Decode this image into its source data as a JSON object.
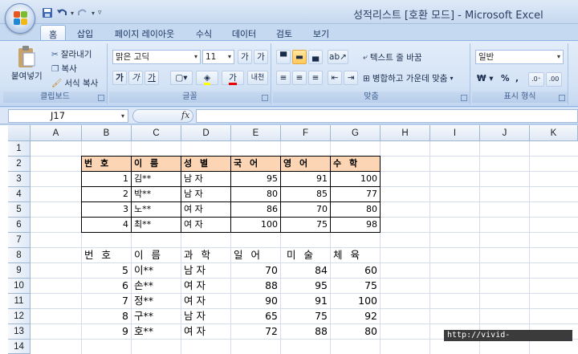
{
  "app": {
    "title": "성적리스트  [호환 모드] - Microsoft Excel"
  },
  "tabs": [
    "홈",
    "삽입",
    "페이지 레이아웃",
    "수식",
    "데이터",
    "검토",
    "보기"
  ],
  "ribbon": {
    "clipboard": {
      "paste": "붙여넣기",
      "cut": "잘라내기",
      "copy": "복사",
      "format_painter": "서식 복사",
      "label": "클립보드"
    },
    "font": {
      "name": "맑은 고딕",
      "size": "11",
      "bold": "가",
      "italic": "가",
      "underline": "가",
      "label": "글꼴",
      "phonetic": "내천"
    },
    "alignment": {
      "wrap": "텍스트 줄 바꿈",
      "merge": "병합하고 가운데 맞춤",
      "label": "맞춤"
    },
    "number": {
      "format": "일반",
      "label": "표시 형식"
    }
  },
  "formula_bar": {
    "cell_ref": "J17",
    "fx": "fx",
    "value": ""
  },
  "columns": [
    "A",
    "B",
    "C",
    "D",
    "E",
    "F",
    "G",
    "H",
    "I",
    "J",
    "K"
  ],
  "rows": [
    "1",
    "2",
    "3",
    "4",
    "5",
    "6",
    "7",
    "8",
    "9",
    "10",
    "11",
    "12",
    "13",
    "14"
  ],
  "table1": {
    "headers": [
      "번 호",
      "이 름",
      "성 별",
      "국 어",
      "영 어",
      "수 학"
    ],
    "rows": [
      [
        "1",
        "김**",
        "남 자",
        "95",
        "91",
        "100"
      ],
      [
        "2",
        "박**",
        "남 자",
        "80",
        "85",
        "77"
      ],
      [
        "3",
        "노**",
        "여 자",
        "86",
        "70",
        "80"
      ],
      [
        "4",
        "최**",
        "여 자",
        "100",
        "75",
        "98"
      ]
    ]
  },
  "table2": {
    "headers": [
      "번 호",
      "이 름",
      "과 학",
      "일 어",
      "미 술",
      "체 육"
    ],
    "rows": [
      [
        "5",
        "이**",
        "남 자",
        "70",
        "84",
        "60"
      ],
      [
        "6",
        "손**",
        "여 자",
        "88",
        "95",
        "75"
      ],
      [
        "7",
        "정**",
        "여 자",
        "90",
        "91",
        "100"
      ],
      [
        "8",
        "구**",
        "남 자",
        "65",
        "75",
        "92"
      ],
      [
        "9",
        "호**",
        "여 자",
        "72",
        "88",
        "80"
      ]
    ]
  },
  "watermark": "http://vivid-daily.tistory.com"
}
